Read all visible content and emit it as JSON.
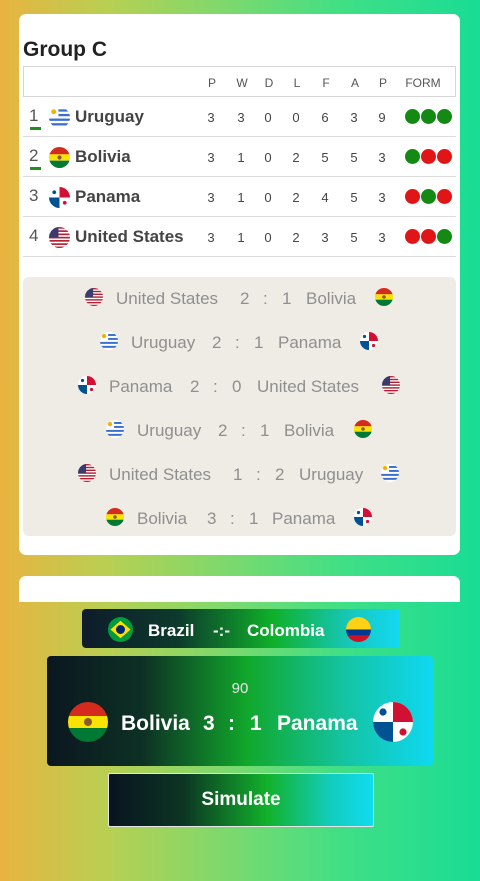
{
  "group": {
    "title": "Group C",
    "columns": [
      "P",
      "W",
      "D",
      "L",
      "F",
      "A",
      "P",
      "FORM"
    ],
    "teams": [
      {
        "pos": "1",
        "flag": "uruguay-flag-icon",
        "name": "Uruguay",
        "stats": [
          "3",
          "3",
          "0",
          "0",
          "6",
          "3",
          "9"
        ],
        "form": [
          "W",
          "W",
          "W"
        ]
      },
      {
        "pos": "2",
        "flag": "bolivia-flag-icon",
        "name": "Bolivia",
        "stats": [
          "3",
          "1",
          "0",
          "2",
          "5",
          "5",
          "3"
        ],
        "form": [
          "W",
          "L",
          "L"
        ]
      },
      {
        "pos": "3",
        "flag": "panama-flag-icon",
        "name": "Panama",
        "stats": [
          "3",
          "1",
          "0",
          "2",
          "4",
          "5",
          "3"
        ],
        "form": [
          "L",
          "W",
          "L"
        ]
      },
      {
        "pos": "4",
        "flag": "usa-flag-icon",
        "name": "United States",
        "stats": [
          "3",
          "1",
          "0",
          "2",
          "3",
          "5",
          "3"
        ],
        "form": [
          "L",
          "L",
          "W"
        ]
      }
    ]
  },
  "matches": [
    {
      "home": "United States",
      "home_score": "2",
      "sep": ":",
      "away_score": "1",
      "away": "Bolivia"
    },
    {
      "home": "Uruguay",
      "home_score": "2",
      "sep": ":",
      "away_score": "1",
      "away": "Panama"
    },
    {
      "home": "Panama",
      "home_score": "2",
      "sep": ":",
      "away_score": "0",
      "away": "United States"
    },
    {
      "home": "Uruguay",
      "home_score": "2",
      "sep": ":",
      "away_score": "1",
      "away": "Bolivia"
    },
    {
      "home": "United States",
      "home_score": "1",
      "sep": ":",
      "away_score": "2",
      "away": "Uruguay"
    },
    {
      "home": "Bolivia",
      "home_score": "3",
      "sep": ":",
      "away_score": "1",
      "away": "Panama"
    }
  ],
  "next_match": {
    "home": "Brazil",
    "separator": "-:-",
    "away": "Colombia",
    "home_flag": "brazil-flag-icon",
    "away_flag": "colombia-flag-icon"
  },
  "live_match": {
    "minute": "90",
    "home": "Bolivia",
    "home_score": "3",
    "sep": ":",
    "away_score": "1",
    "away": "Panama",
    "home_flag": "bolivia-flag-icon",
    "away_flag": "panama-flag-icon"
  },
  "simulate_label": "Simulate",
  "colors": {
    "win": "#148a14",
    "loss": "#e01515",
    "qualified": "#1f8f1f"
  }
}
